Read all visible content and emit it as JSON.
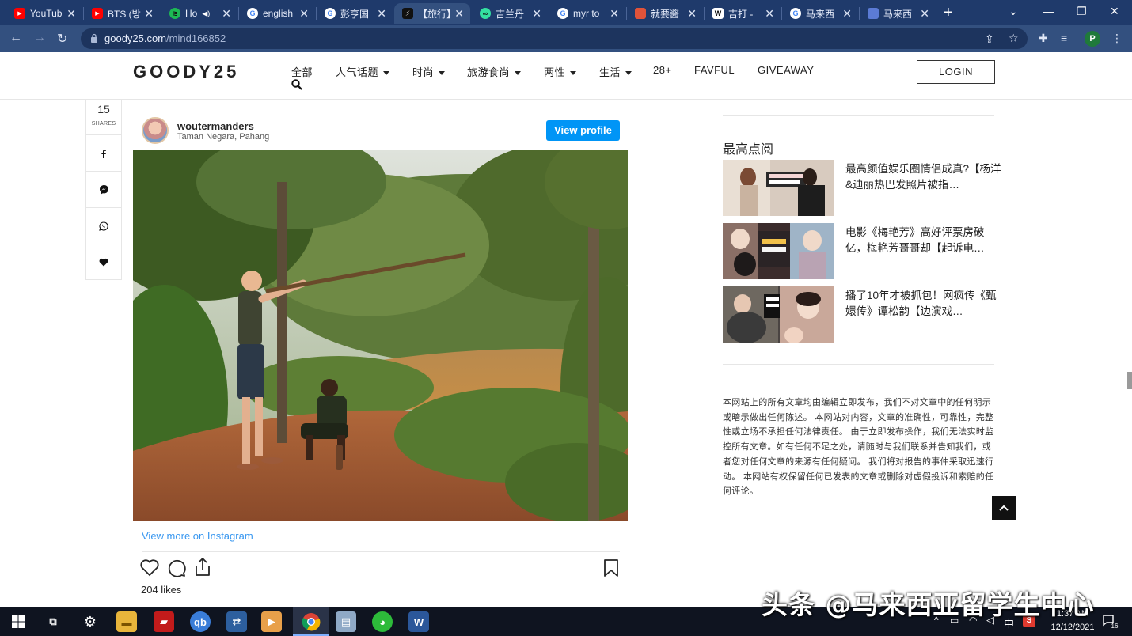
{
  "browser": {
    "tabs": [
      {
        "label": "YouTub",
        "favicon": "youtube-icon",
        "color": "#ff0000"
      },
      {
        "label": "BTS (방",
        "favicon": "youtube-icon",
        "color": "#ff0000"
      },
      {
        "label": "Ho",
        "favicon": "spotify-icon",
        "color": "#1db954"
      },
      {
        "label": "english",
        "favicon": "google-icon",
        "color": "#ffffff"
      },
      {
        "label": "彭亨国",
        "favicon": "google-icon",
        "color": "#ffffff"
      },
      {
        "label": "【旅行】",
        "favicon": "goody-icon",
        "color": "#111111"
      },
      {
        "label": "吉兰丹",
        "favicon": "tripadvisor-icon",
        "color": "#34e0a1"
      },
      {
        "label": "myr to",
        "favicon": "google-icon",
        "color": "#ffffff"
      },
      {
        "label": "就要酱",
        "favicon": "brave-icon",
        "color": "#e0533a"
      },
      {
        "label": "吉打 -",
        "favicon": "wikipedia-icon",
        "color": "#ffffff"
      },
      {
        "label": "马来西",
        "favicon": "google-icon",
        "color": "#ffffff"
      },
      {
        "label": "马来西",
        "favicon": "site-icon",
        "color": "#5b7bd5"
      }
    ],
    "url_host": "goody25.com",
    "url_path": "/mind166852",
    "profile_initial": "P"
  },
  "site": {
    "logo": "GOODY25",
    "nav": [
      {
        "label": "全部",
        "dropdown": false
      },
      {
        "label": "人气话题",
        "dropdown": true
      },
      {
        "label": "时尚",
        "dropdown": true
      },
      {
        "label": "旅游食尚",
        "dropdown": true
      },
      {
        "label": "两性",
        "dropdown": true
      },
      {
        "label": "生活",
        "dropdown": true
      },
      {
        "label": "28+",
        "dropdown": false
      },
      {
        "label": "FAVFUL",
        "dropdown": false
      },
      {
        "label": "GIVEAWAY",
        "dropdown": false
      }
    ],
    "login": "LOGIN"
  },
  "share": {
    "count": "15",
    "label": "SHARES"
  },
  "instagram": {
    "username": "woutermanders",
    "location": "Taman Negara, Pahang",
    "view_profile": "View profile",
    "view_more": "View more on Instagram",
    "likes": "204 likes"
  },
  "sidebar": {
    "title": "最高点阅",
    "items": [
      {
        "title": "最高颜值娱乐圈情侣成真?【杨洋&迪丽热巴发照片被指…"
      },
      {
        "title": "电影《梅艳芳》高好评票房破亿，梅艳芳哥哥却【起诉电…"
      },
      {
        "title": "播了10年才被抓包！网疯传《甄嬛传》谭松韵【边演戏…"
      }
    ],
    "disclaimer": "本网站上的所有文章均由编辑立即发布，我们不对文章中的任何明示或暗示做出任何陈述。 本网站对内容，文章的准确性，可靠性，完整性或立场不承担任何法律责任。 由于立即发布操作，我们无法实时监控所有文章。如有任何不足之处，请随时与我们联系并告知我们，或者您对任何文章的来源有任何疑问。 我们将对报告的事件采取迅速行动。 本网站有权保留任何已发表的文章或删除对虚假投诉和索赔的任何评论。"
  },
  "taskbar": {
    "time": "1:37 AM",
    "date": "12/12/2021",
    "lang": "中",
    "notifications": "16"
  },
  "watermark": "头条 @马来西亚留学生中心"
}
